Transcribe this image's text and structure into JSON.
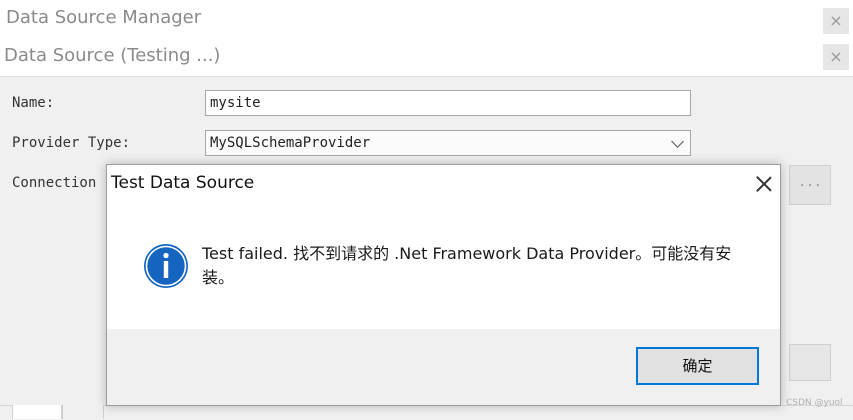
{
  "outer_window": {
    "title": "Data Source Manager",
    "close_label": "×"
  },
  "inner_window": {
    "title": "Data Source (Testing ...)",
    "close_label": "×"
  },
  "form": {
    "name_label": "Name:",
    "name_value": "mysite",
    "provider_label": "Provider Type:",
    "provider_value": "MySQLSchemaProvider",
    "connection_label": "Connection",
    "browse_label": "..."
  },
  "dialog": {
    "title": "Test Data Source",
    "message": "Test failed. 找不到请求的 .Net Framework Data Provider。可能没有安装。",
    "icon": "info-icon",
    "ok_label": "确定"
  },
  "watermark": "CSDN @yuol",
  "colors": {
    "accent": "#0078d7",
    "info_icon": "#1565c0"
  }
}
